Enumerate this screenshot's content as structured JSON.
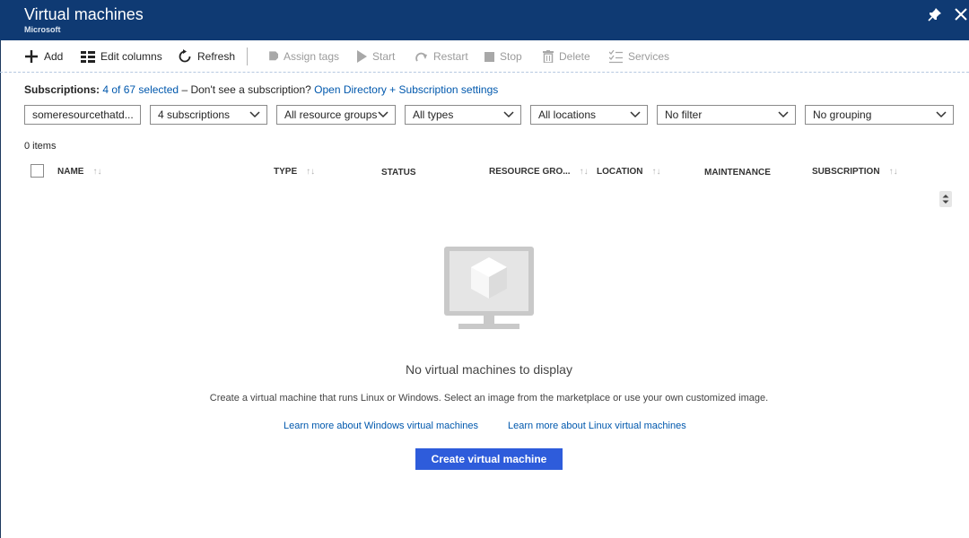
{
  "header": {
    "title": "Virtual machines",
    "subtitle": "Microsoft",
    "pin_icon": "pin-icon",
    "close_icon": "close-icon",
    "background_color": "#0f3a73"
  },
  "toolbar": {
    "add": "Add",
    "edit_columns": "Edit columns",
    "refresh": "Refresh",
    "assign_tags": "Assign tags",
    "start": "Start",
    "restart": "Restart",
    "stop": "Stop",
    "delete": "Delete",
    "services": "Services"
  },
  "subscriptions": {
    "label": "Subscriptions:",
    "selected": "4 of 67 selected",
    "question": "– Don't see a subscription?",
    "settings_link": "Open Directory + Subscription settings"
  },
  "filters": {
    "search_value": "someresourcethatd...",
    "subscriptions": "4 subscriptions",
    "resource_groups": "All resource groups",
    "types": "All types",
    "locations": "All locations",
    "filter": "No filter",
    "grouping": "No grouping"
  },
  "list": {
    "count": "0 items",
    "columns": [
      "NAME",
      "TYPE",
      "STATUS",
      "RESOURCE GRO...",
      "LOCATION",
      "MAINTENANCE",
      "SUBSCRIPTION"
    ]
  },
  "empty": {
    "title": "No virtual machines to display",
    "description": "Create a virtual machine that runs Linux or Windows. Select an image from the marketplace or use your own customized image.",
    "windows_link": "Learn more about Windows virtual machines",
    "linux_link": "Learn more about Linux virtual machines",
    "create_button": "Create virtual machine",
    "button_color": "#2e5cdb"
  }
}
